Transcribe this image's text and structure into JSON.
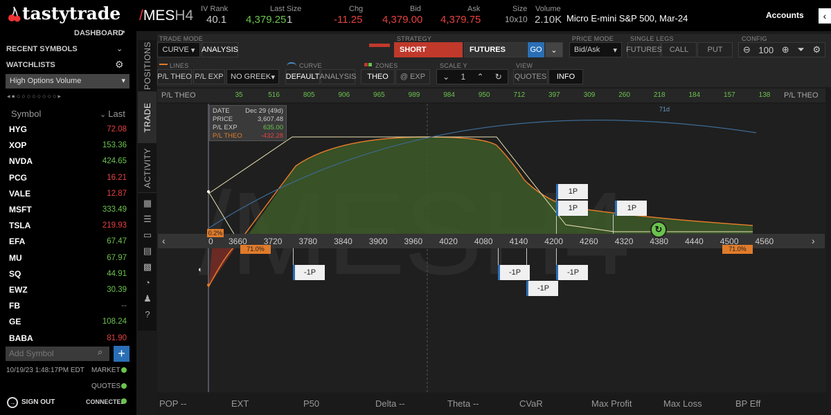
{
  "brand": {
    "name": "tastytrade",
    "dashboard_link": "DASHBOARD"
  },
  "header": {
    "symbol_slash": "/",
    "symbol_main": "MES",
    "symbol_suffix": "H4",
    "iv_rank_label": "IV Rank",
    "iv_rank": "40.1",
    "last_size_label": "Last Size",
    "last_price": "4,379.25",
    "last_size": "1",
    "chg_label": "Chg",
    "chg": "-11.25",
    "bid_label": "Bid",
    "bid": "4,379.00",
    "ask_label": "Ask",
    "ask": "4,379.75",
    "size_label": "Size",
    "size": "10x10",
    "volume_label": "Volume",
    "volume": "2.10K",
    "description": "Micro E-mini S&P 500, Mar-24",
    "accounts_label": "Accounts"
  },
  "sidebar": {
    "recent_symbols": "RECENT SYMBOLS",
    "watchlists": "WATCHLISTS",
    "watchlist_selected": "High Options Volume",
    "col_symbol": "Symbol",
    "col_last": "Last",
    "rows": [
      {
        "symbol": "HYG",
        "last": "72.08",
        "dir": "down"
      },
      {
        "symbol": "XOP",
        "last": "153.36",
        "dir": "up"
      },
      {
        "symbol": "NVDA",
        "last": "424.65",
        "dir": "up"
      },
      {
        "symbol": "PCG",
        "last": "16.21",
        "dir": "down"
      },
      {
        "symbol": "VALE",
        "last": "12.87",
        "dir": "down"
      },
      {
        "symbol": "MSFT",
        "last": "333.49",
        "dir": "up"
      },
      {
        "symbol": "TSLA",
        "last": "219.93",
        "dir": "down"
      },
      {
        "symbol": "EFA",
        "last": "67.47",
        "dir": "up"
      },
      {
        "symbol": "MU",
        "last": "67.97",
        "dir": "up"
      },
      {
        "symbol": "SQ",
        "last": "44.91",
        "dir": "up"
      },
      {
        "symbol": "EWZ",
        "last": "30.39",
        "dir": "up"
      },
      {
        "symbol": "FB",
        "last": "--",
        "dir": "none"
      },
      {
        "symbol": "GE",
        "last": "108.24",
        "dir": "up"
      },
      {
        "symbol": "BABA",
        "last": "81.90",
        "dir": "down"
      }
    ],
    "add_symbol_placeholder": "Add Symbol",
    "timestamp": "10/19/23 1:48:17PM EDT",
    "market": "MARKET",
    "quotes": "QUOTES",
    "sign_out": "SIGN OUT",
    "connected": "CONNECTED"
  },
  "side_tabs": [
    "POSITIONS",
    "TRADE",
    "ACTIVITY"
  ],
  "controls": {
    "trade_mode_label": "TRADE MODE",
    "curve": "CURVE",
    "analysis": "ANALYSIS",
    "strategy_label": "STRATEGY",
    "short": "SHORT",
    "futures": "FUTURES",
    "go": "GO",
    "price_mode_label": "PRICE MODE",
    "price_mode": "Bid/Ask",
    "single_legs_label": "SINGLE LEGS",
    "sl_futures": "FUTURES",
    "sl_call": "CALL",
    "sl_put": "PUT",
    "config_label": "CONFIG",
    "zoom": "100",
    "lines_label": "LINES",
    "pl_theo": "P/L THEO",
    "pl_exp": "P/L EXP",
    "no_greek": "NO GREEK",
    "curve_label": "CURVE",
    "default": "DEFAULT",
    "analysis2": "ANALYSIS",
    "zones_label": "ZONES",
    "theo": "THEO",
    "at_exp": "@ EXP",
    "scale_label": "SCALE Y",
    "scale_val": "1",
    "view_label": "VIEW",
    "quotes": "QUOTES",
    "info": "INFO"
  },
  "pl_row": {
    "left_label": "P/L THEO",
    "right_label": "P/L THEO",
    "values": [
      "35",
      "516",
      "805",
      "906",
      "965",
      "989",
      "984",
      "950",
      "712",
      "397",
      "309",
      "260",
      "218",
      "184",
      "157",
      "138"
    ]
  },
  "tooltip": {
    "date_label": "DATE",
    "date": "Dec 29 (49d)",
    "price_label": "PRICE",
    "price": "3,607.48",
    "plexp_label": "P/L EXP",
    "plexp": "635.00",
    "pltheo_label": "P/L THEO",
    "pltheo": "-432.28"
  },
  "chart": {
    "watermark": "/MESH4",
    "days_label": "71d",
    "axis_start": "0",
    "x_ticks": [
      "3660",
      "3720",
      "3780",
      "3840",
      "3900",
      "3960",
      "4020",
      "4080",
      "4140",
      "4200",
      "4260",
      "4320",
      "4380",
      "4440",
      "4500",
      "4560"
    ],
    "pct_left": "71.0%",
    "pct_right": "71.0%",
    "pct_small": "0.2%",
    "legs_up": [
      "1P",
      "1P",
      "1P"
    ],
    "legs_down": [
      "-1P",
      "-1P",
      "-1P",
      "-1P"
    ]
  },
  "bottom": [
    "POP --",
    "EXT",
    "P50",
    "Delta --",
    "Theta --",
    "CVaR",
    "Max Profit",
    "Max Loss",
    "BP Eff"
  ],
  "colors": {
    "accent_red": "#c0392b",
    "green": "#6bc34d",
    "loss": "#e64141",
    "orange": "#e07b2a"
  }
}
